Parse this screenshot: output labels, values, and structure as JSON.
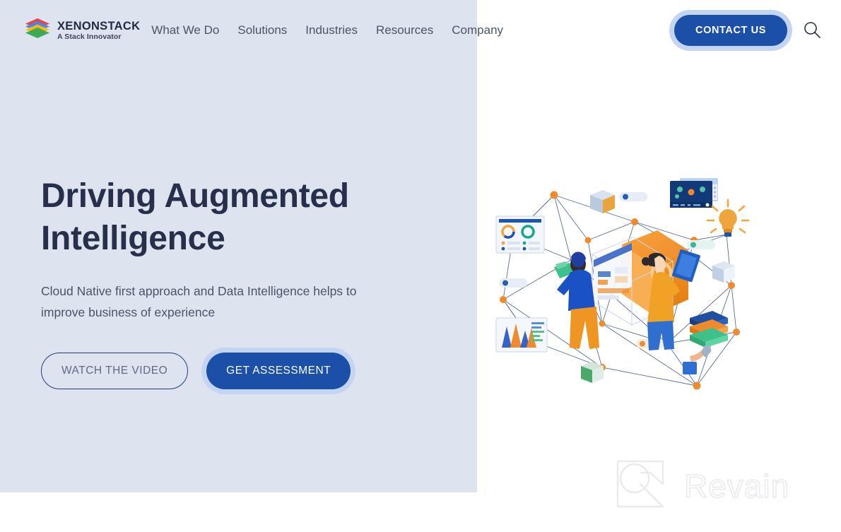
{
  "brand": {
    "name": "XENONSTACK",
    "tagline": "A Stack Innovator",
    "logo_icon": "stacked-layers-logo",
    "logo_colors": [
      "#e8453c",
      "#4285f4",
      "#fbbc05",
      "#34a853"
    ]
  },
  "nav": {
    "items": [
      {
        "label": "What We Do"
      },
      {
        "label": "Solutions"
      },
      {
        "label": "Industries"
      },
      {
        "label": "Resources"
      },
      {
        "label": "Company"
      }
    ]
  },
  "header": {
    "contact_label": "CONTACT US",
    "search_icon": "search-icon",
    "accent_color": "#1c50a8",
    "halo_color": "#c3d5f2"
  },
  "hero": {
    "title": "Driving Augmented Intelligence",
    "title_line1": "Driving Augmented",
    "title_line2": "Intelligence",
    "subtitle": "Cloud Native first approach and Data Intelligence helps to improve business of experience",
    "primary_cta": "GET ASSESSMENT",
    "secondary_cta": "WATCH THE VIDEO",
    "background_color": "#dde3ef",
    "title_color": "#26304a"
  },
  "illustration": {
    "name": "augmented-intelligence-network-illustration",
    "description": "Isometric network mesh with two people, data cards, dashboard screen, lightbulb and central orange cube",
    "node_color": "#ef8b2c",
    "line_color": "#4a5f86"
  },
  "watermark": {
    "text": "Revain",
    "icon": "revain-logo-icon",
    "color": "#e8eaee"
  }
}
